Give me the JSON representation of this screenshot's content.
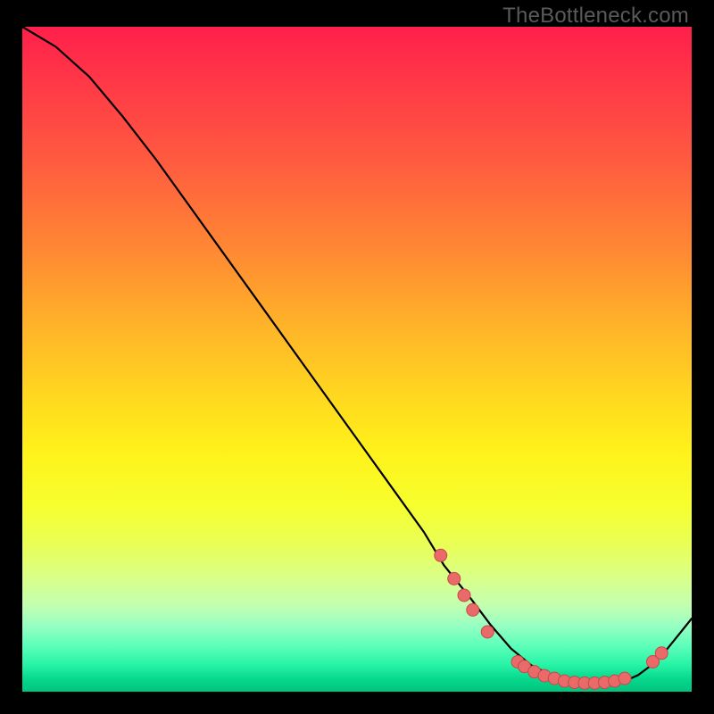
{
  "watermark": "TheBottleneck.com",
  "chart_data": {
    "type": "line",
    "title": "",
    "xlabel": "",
    "ylabel": "",
    "xlim": [
      0,
      100
    ],
    "ylim": [
      0,
      100
    ],
    "series": [
      {
        "name": "curve",
        "x": [
          0,
          5,
          10,
          15,
          20,
          25,
          30,
          35,
          40,
          45,
          50,
          55,
          60,
          63,
          67,
          70,
          73,
          76,
          80,
          83,
          86,
          88,
          90,
          92,
          94,
          96,
          98,
          100
        ],
        "y": [
          100,
          97,
          92.5,
          86.5,
          80,
          73,
          66,
          59,
          52,
          45,
          38,
          31,
          24,
          19,
          14,
          10,
          6.5,
          4,
          2,
          1.3,
          1.1,
          1.2,
          1.6,
          2.5,
          4,
          6,
          8.5,
          11
        ]
      }
    ],
    "markers": [
      {
        "x": 62.5,
        "y": 20.5
      },
      {
        "x": 64.5,
        "y": 17
      },
      {
        "x": 66.0,
        "y": 14.5
      },
      {
        "x": 67.3,
        "y": 12.3
      },
      {
        "x": 69.5,
        "y": 9
      },
      {
        "x": 74.0,
        "y": 4.5
      },
      {
        "x": 75.0,
        "y": 3.8
      },
      {
        "x": 76.5,
        "y": 3.0
      },
      {
        "x": 78.0,
        "y": 2.4
      },
      {
        "x": 79.5,
        "y": 2.0
      },
      {
        "x": 81.0,
        "y": 1.6
      },
      {
        "x": 82.5,
        "y": 1.4
      },
      {
        "x": 84.0,
        "y": 1.3
      },
      {
        "x": 85.5,
        "y": 1.3
      },
      {
        "x": 87.0,
        "y": 1.4
      },
      {
        "x": 88.5,
        "y": 1.6
      },
      {
        "x": 90.0,
        "y": 2.0
      },
      {
        "x": 94.2,
        "y": 4.5
      },
      {
        "x": 95.5,
        "y": 5.8
      }
    ],
    "colors": {
      "curve": "#000000",
      "marker_fill": "#ea6a6a",
      "marker_stroke": "#c64949"
    }
  }
}
